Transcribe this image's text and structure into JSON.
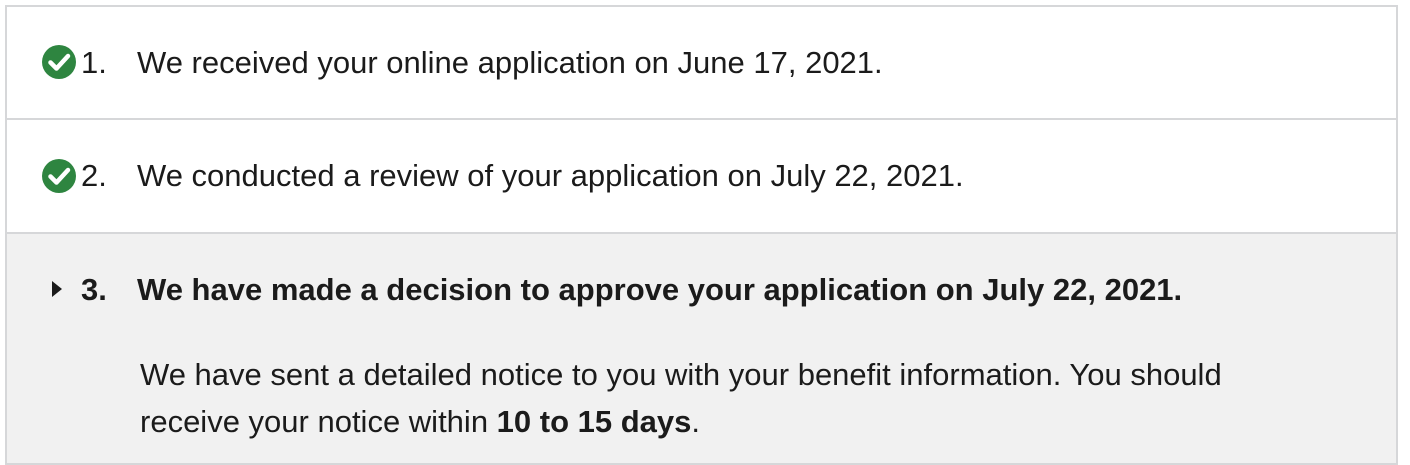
{
  "steps": [
    {
      "number": "1.",
      "status": "complete",
      "icon": "check-circle-icon",
      "text": "We received your online application on June 17, 2021."
    },
    {
      "number": "2.",
      "status": "complete",
      "icon": "check-circle-icon",
      "text": "We conducted a review of your application on July 22, 2021."
    },
    {
      "number": "3.",
      "status": "current",
      "icon": "caret-right-icon",
      "text": "We have made a decision to approve your application on July 22, 2021.",
      "detail": {
        "before": "We have sent a detailed notice to you with your benefit information. You should receive your notice within ",
        "bold": "10 to 15 days",
        "after": "."
      }
    }
  ],
  "colors": {
    "check": "#2e8540",
    "border": "#d6d7d9",
    "current_bg": "#f1f1f1",
    "text": "#1b1b1b"
  }
}
